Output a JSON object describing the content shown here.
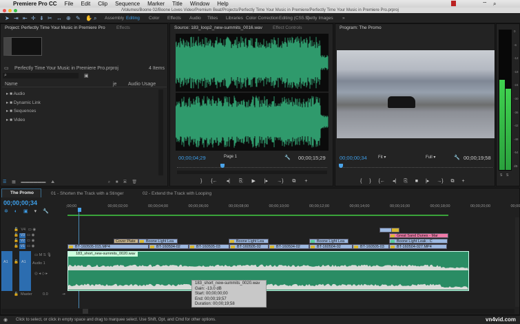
{
  "menubar": {
    "apple": "",
    "app": "Premiere Pro CC",
    "items": [
      "File",
      "Edit",
      "Clip",
      "Sequence",
      "Marker",
      "Title",
      "Window",
      "Help"
    ]
  },
  "window": {
    "path": "/Volumes/Boone 02/Boone Loves Video/Premium Beat/Projects/Perfectly Time Your Music in Premiere/Perfectly Time Your Music in Premiere Pro.prproj"
  },
  "workspaces": [
    "Assembly",
    "Editing",
    "Color",
    "Effects",
    "Audio",
    "Titles",
    "Libraries",
    "Color Correction",
    "Editing (CS5.5)",
    "Getty Images",
    "»"
  ],
  "active_workspace": "Editing",
  "project": {
    "tab": "Project: Perfectly Time Your Music in Premiere Pro",
    "tab2": "Effects",
    "file": "Perfectly Time Your Music in Premiere Pro.prproj",
    "count": "4 Items",
    "col_name": "Name",
    "col_mid": "je",
    "col_audio": "Audio Usage",
    "items": [
      "Audio",
      "Dynamic Link",
      "Sequences",
      "Video"
    ]
  },
  "source": {
    "tab": "Source: 183_loop2_new-summits_0016.wav",
    "tab2": "Effect Controls",
    "timecode": "00;00;04;29",
    "page": "Page 1",
    "duration": "00;00;15;29"
  },
  "program": {
    "tab": "Program: The Promo",
    "timecode": "00;00;00;34",
    "fit": "Fit",
    "quality": "Full",
    "duration": "00;00;19;58"
  },
  "meters": {
    "scale": [
      "0",
      "-6",
      "-12",
      "-18",
      "-24",
      "-30",
      "-36",
      "-42",
      "-48",
      "-54",
      "dB"
    ],
    "solo": [
      "S",
      "S"
    ],
    "left_level_db": -20,
    "right_level_db": -24
  },
  "timeline": {
    "tabs": [
      "The Promo",
      "01 - Shorten the Track with a Stinger",
      "02 - Extend the Track with Looping"
    ],
    "timecode": "00;00;00;34",
    "ruler": [
      ";00;00",
      "00;00;02;00",
      "00;00;04;00",
      "00;00;06;00",
      "00;00;08;00",
      "00;00;10;00",
      "00;00;12;00",
      "00;00;14;00",
      "00;00;16;00",
      "00;00;18;00",
      "00;00;20;00",
      "00;00;2"
    ],
    "tracks": {
      "v4": "V4",
      "v3": "V3",
      "v2": "V2",
      "v1": "V1",
      "a1": "A1",
      "a1_name": "Audio 1",
      "a1_src": "A1",
      "master": "Master",
      "master_val": "0.0"
    },
    "clips": {
      "v4": [
        {
          "label": ""
        },
        {
          "label": ""
        }
      ],
      "v3": [
        {
          "label": "Great Sand Dunes - Mar"
        }
      ],
      "v2": [
        {
          "label": "Cover Plate"
        },
        {
          "label": "Boone Light Lea"
        },
        {
          "label": "Boone Light Lea"
        },
        {
          "label": "Boone Light Lea"
        },
        {
          "label": "Boone Light Leak - C"
        }
      ],
      "v1": [
        {
          "label": "BT-160505-015.MP4"
        },
        {
          "label": "BT-160504-02"
        },
        {
          "label": "BT-160505-03"
        },
        {
          "label": "BT-160505-02"
        },
        {
          "label": "BT-160504-02"
        },
        {
          "label": "BT-160504-02"
        },
        {
          "label": "BT-160505-03"
        },
        {
          "label": "BT-160504-027.MP4"
        }
      ],
      "a1": {
        "label": "183_short_new-summits_0020.wav"
      }
    },
    "tooltip": [
      "183_short_new-summits_0020.wav",
      "Gain: -13.0 dB",
      "Start: 00;00;00;00",
      "End: 00;00;19;57",
      "Duration: 00;00;19;58"
    ]
  },
  "status": "Click to select, or click in empty space and drag to marquee select. Use Shift, Opt, and Cmd for other options.",
  "watermark": "vn4vid.com"
}
